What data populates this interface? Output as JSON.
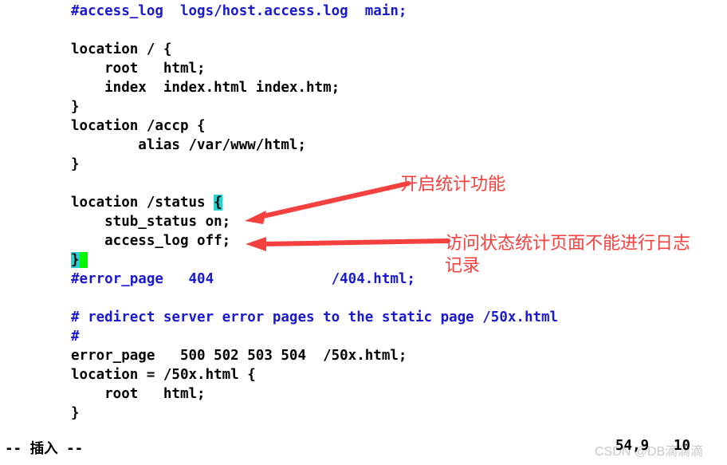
{
  "editor": {
    "app": "vim",
    "filetype": "nginx-conf",
    "lines": [
      {
        "segments": [
          {
            "text": "#access_log  logs/host.access.log  main;",
            "style": "comment"
          }
        ]
      },
      {
        "segments": []
      },
      {
        "segments": [
          {
            "text": "location / {",
            "style": "code"
          }
        ]
      },
      {
        "segments": [
          {
            "text": "    root   html;",
            "style": "code"
          }
        ]
      },
      {
        "segments": [
          {
            "text": "    index  index.html index.htm;",
            "style": "code"
          }
        ]
      },
      {
        "segments": [
          {
            "text": "}",
            "style": "code"
          }
        ]
      },
      {
        "segments": [
          {
            "text": "location /accp {",
            "style": "code"
          }
        ]
      },
      {
        "segments": [
          {
            "text": "        alias /var/www/html;",
            "style": "code"
          }
        ]
      },
      {
        "segments": [
          {
            "text": "}",
            "style": "code"
          }
        ]
      },
      {
        "segments": []
      },
      {
        "segments": [
          {
            "text": "location /status ",
            "style": "code"
          },
          {
            "text": "{",
            "style": "match"
          }
        ]
      },
      {
        "segments": [
          {
            "text": "    stub_status on;",
            "style": "code"
          }
        ]
      },
      {
        "segments": [
          {
            "text": "    access_log off;",
            "style": "code"
          }
        ]
      },
      {
        "segments": [
          {
            "text": "}",
            "style": "match"
          },
          {
            "text": " ",
            "style": "cursor"
          }
        ]
      },
      {
        "segments": [
          {
            "text": "#error_page   404              /404.html;",
            "style": "comment"
          }
        ]
      },
      {
        "segments": []
      },
      {
        "segments": [
          {
            "text": "# redirect server error pages to the static page /50x.html",
            "style": "comment"
          }
        ]
      },
      {
        "segments": [
          {
            "text": "#",
            "style": "comment"
          }
        ]
      },
      {
        "segments": [
          {
            "text": "error_page   500 502 503 504  /50x.html;",
            "style": "code"
          }
        ]
      },
      {
        "segments": [
          {
            "text": "location = /50x.html {",
            "style": "code"
          }
        ]
      },
      {
        "segments": [
          {
            "text": "    root   html;",
            "style": "code"
          }
        ]
      },
      {
        "segments": [
          {
            "text": "}",
            "style": "code"
          }
        ]
      }
    ]
  },
  "statusline": {
    "mode": "-- 插入 --",
    "ruler": "54,9",
    "percent": "10",
    "watermark": "CSDN @DB滴滴滴"
  },
  "annotations": {
    "color": "#f4413f",
    "items": [
      {
        "id": "enable-stats",
        "text": "开启统计功能"
      },
      {
        "id": "no-access-log",
        "text": "访问状态统计页面不能进行日志\n记录"
      }
    ]
  },
  "colors": {
    "background": "#ffffff",
    "code": "#000000",
    "comment": "#1a1acd",
    "match_bracket_bg": "#28d0d0",
    "cursor_bg": "#00f900",
    "annotation": "#f4413f",
    "watermark": "#c9c9c9"
  }
}
